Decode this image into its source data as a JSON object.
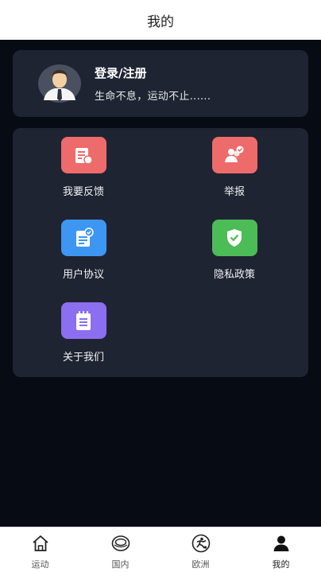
{
  "header": {
    "title": "我的"
  },
  "profile": {
    "login_label": "登录/注册",
    "slogan": "生命不息，运动不止......"
  },
  "menu": {
    "items": [
      {
        "label": "我要反馈",
        "icon": "feedback-icon",
        "color": "#ee6b6b"
      },
      {
        "label": "举报",
        "icon": "report-user-icon",
        "color": "#ee6b6b"
      },
      {
        "label": "用户协议",
        "icon": "user-agreement-icon",
        "color": "#3d96f2"
      },
      {
        "label": "隐私政策",
        "icon": "privacy-shield-icon",
        "color": "#4cbc56"
      },
      {
        "label": "关于我们",
        "icon": "about-notebook-icon",
        "color": "#8c6ef0"
      }
    ]
  },
  "tabbar": {
    "tabs": [
      {
        "label": "运动",
        "icon": "home-icon"
      },
      {
        "label": "国内",
        "icon": "ring-icon"
      },
      {
        "label": "欧洲",
        "icon": "football-player-icon"
      },
      {
        "label": "我的",
        "icon": "person-icon",
        "active": true
      }
    ]
  },
  "colors": {
    "background": "#070b14",
    "card": "#1f2432",
    "header": "#ffffff"
  }
}
